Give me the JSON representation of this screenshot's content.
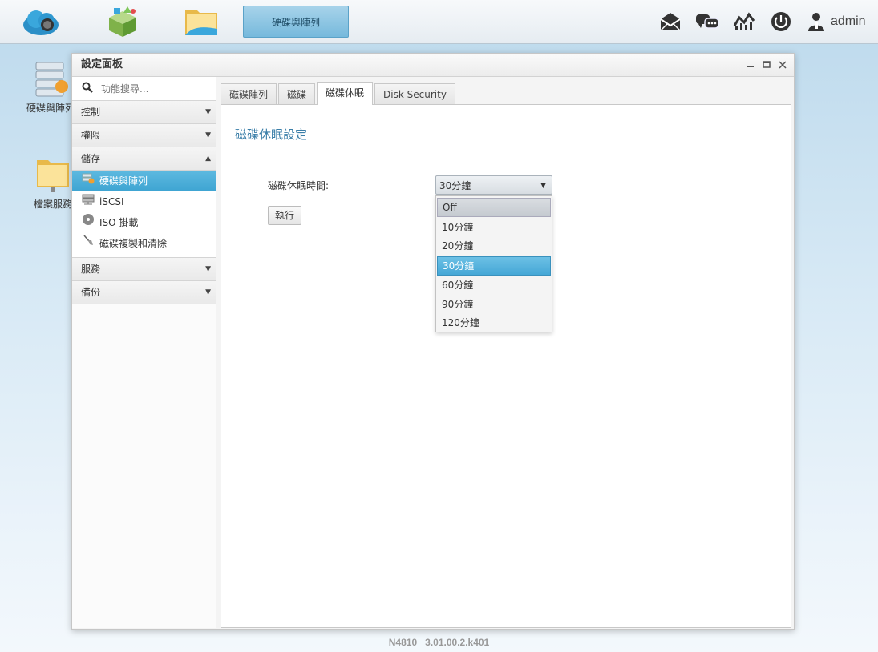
{
  "taskbar": {
    "active_app_label": "硬碟與陣列",
    "user": "admin"
  },
  "desktop": {
    "icons": [
      {
        "label": "硬碟與陣列"
      },
      {
        "label": "檔案服務"
      }
    ]
  },
  "window": {
    "title": "設定面板"
  },
  "sidebar": {
    "search_placeholder": "功能搜尋...",
    "sections": [
      {
        "label": "控制"
      },
      {
        "label": "權限"
      },
      {
        "label": "儲存"
      },
      {
        "label": "服務"
      },
      {
        "label": "備份"
      }
    ],
    "storage_items": [
      {
        "label": "硬碟與陣列"
      },
      {
        "label": "iSCSI"
      },
      {
        "label": "ISO 掛載"
      },
      {
        "label": "磁碟複製和清除"
      }
    ]
  },
  "tabs": [
    {
      "label": "磁碟陣列"
    },
    {
      "label": "磁碟"
    },
    {
      "label": "磁碟休眠"
    },
    {
      "label": "Disk Security"
    }
  ],
  "panel": {
    "title": "磁碟休眠設定",
    "field_label": "磁碟休眠時間:",
    "selected_value": "30分鐘",
    "run_button": "執行",
    "options": [
      "Off",
      "10分鐘",
      "20分鐘",
      "30分鐘",
      "60分鐘",
      "90分鐘",
      "120分鐘"
    ]
  },
  "footer": {
    "model": "N4810",
    "version": "3.01.00.2.k401"
  },
  "colors": {
    "accent": "#45a7d6",
    "title_blue": "#3a7ea8"
  }
}
